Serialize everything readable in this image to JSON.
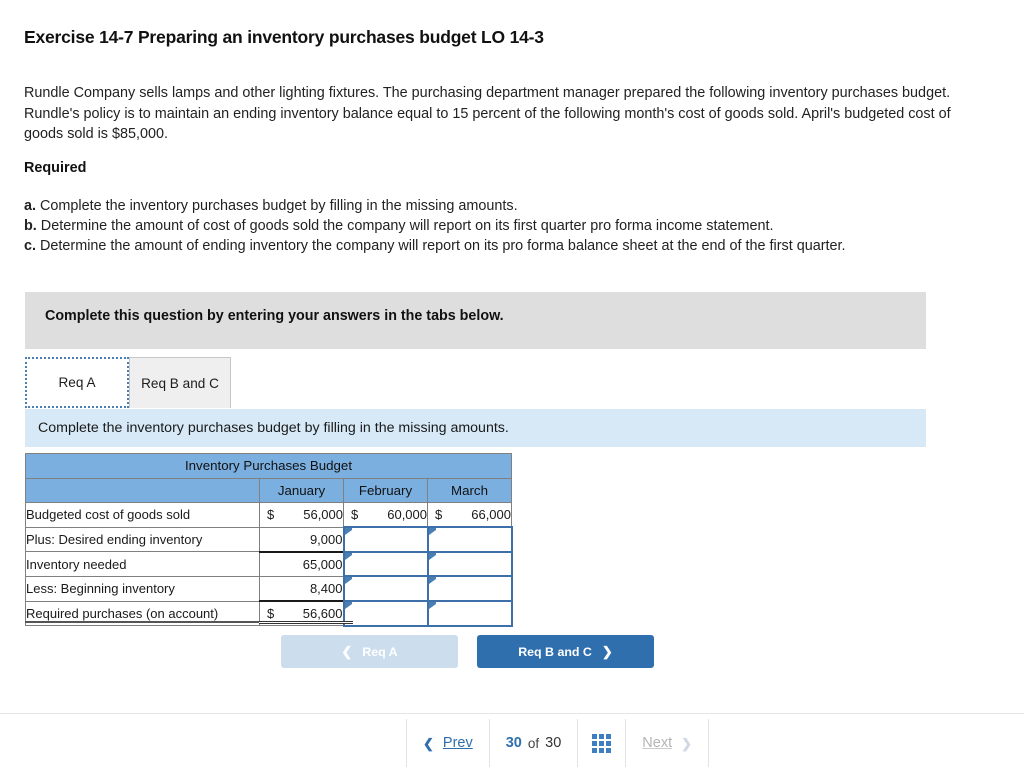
{
  "question": {
    "title": "Exercise 14-7 Preparing an inventory purchases budget LO 14-3",
    "body": "Rundle Company sells lamps and other lighting fixtures. The purchasing department manager prepared the following inventory purchases budget. Rundle's policy is to maintain an ending inventory balance equal to 15 percent of the following month's cost of goods sold. April's budgeted cost of goods sold is $85,000.",
    "required_heading": "Required",
    "required_items": [
      {
        "letter": "a.",
        "text": "Complete the inventory purchases budget by filling in the missing amounts."
      },
      {
        "letter": "b.",
        "text": "Determine the amount of cost of goods sold the company will report on its first quarter pro forma income statement."
      },
      {
        "letter": "c.",
        "text": "Determine the amount of ending inventory the company will report on its pro forma balance sheet at the end of the first quarter."
      }
    ]
  },
  "banner": {
    "instruction": "Complete this question by entering your answers in the tabs below."
  },
  "tabs": [
    {
      "label": "Req A",
      "active": true
    },
    {
      "label": "Req B and C",
      "active": false
    }
  ],
  "sub_instruction": "Complete the inventory purchases budget by filling in the missing amounts.",
  "table": {
    "title": "Inventory Purchases Budget",
    "columns": [
      "",
      "January",
      "February",
      "March"
    ],
    "rows": [
      {
        "label": "Budgeted cost of goods sold",
        "cells": [
          {
            "currency": "$",
            "value": "56,000",
            "input": false
          },
          {
            "currency": "$",
            "value": "60,000",
            "input": false
          },
          {
            "currency": "$",
            "value": "66,000",
            "input": false
          }
        ]
      },
      {
        "label": "Plus: Desired ending inventory",
        "cells": [
          {
            "currency": "",
            "value": "9,000",
            "input": false
          },
          {
            "currency": "",
            "value": "",
            "input": true
          },
          {
            "currency": "",
            "value": "",
            "input": true
          }
        ]
      },
      {
        "label": "Inventory needed",
        "cells": [
          {
            "currency": "",
            "value": "65,000",
            "input": false
          },
          {
            "currency": "",
            "value": "",
            "input": true
          },
          {
            "currency": "",
            "value": "",
            "input": true
          }
        ]
      },
      {
        "label": "Less: Beginning inventory",
        "cells": [
          {
            "currency": "",
            "value": "8,400",
            "input": false
          },
          {
            "currency": "",
            "value": "",
            "input": true
          },
          {
            "currency": "",
            "value": "",
            "input": true
          }
        ]
      },
      {
        "label": "Required purchases (on account)",
        "cells": [
          {
            "currency": "$",
            "value": "56,600",
            "input": false
          },
          {
            "currency": "",
            "value": "",
            "input": true
          },
          {
            "currency": "",
            "value": "",
            "input": true
          }
        ]
      }
    ]
  },
  "req_nav": {
    "prev_label": "Req A",
    "prev_chevron": "chevron-left-icon",
    "next_label": "Req B and C",
    "next_chevron": "chevron-right-icon",
    "prev_color": "#ccdeee",
    "next_color": "#2f6fad"
  },
  "footer": {
    "prev_label": "Prev",
    "prev_chevron": "chevron-left-icon",
    "current_page": "30",
    "of_label": "of",
    "total_pages": "30",
    "grid_icon": "grid-view-icon",
    "next_label": "Next",
    "next_chevron": "chevron-right-icon",
    "accent_color": "#2f6fad"
  },
  "colors": {
    "table_header_blue": "#7aafe0",
    "sub_instruction_blue": "#d7e9f7",
    "banner_gray": "#dedede",
    "input_border_blue": "#3d6fa8"
  }
}
